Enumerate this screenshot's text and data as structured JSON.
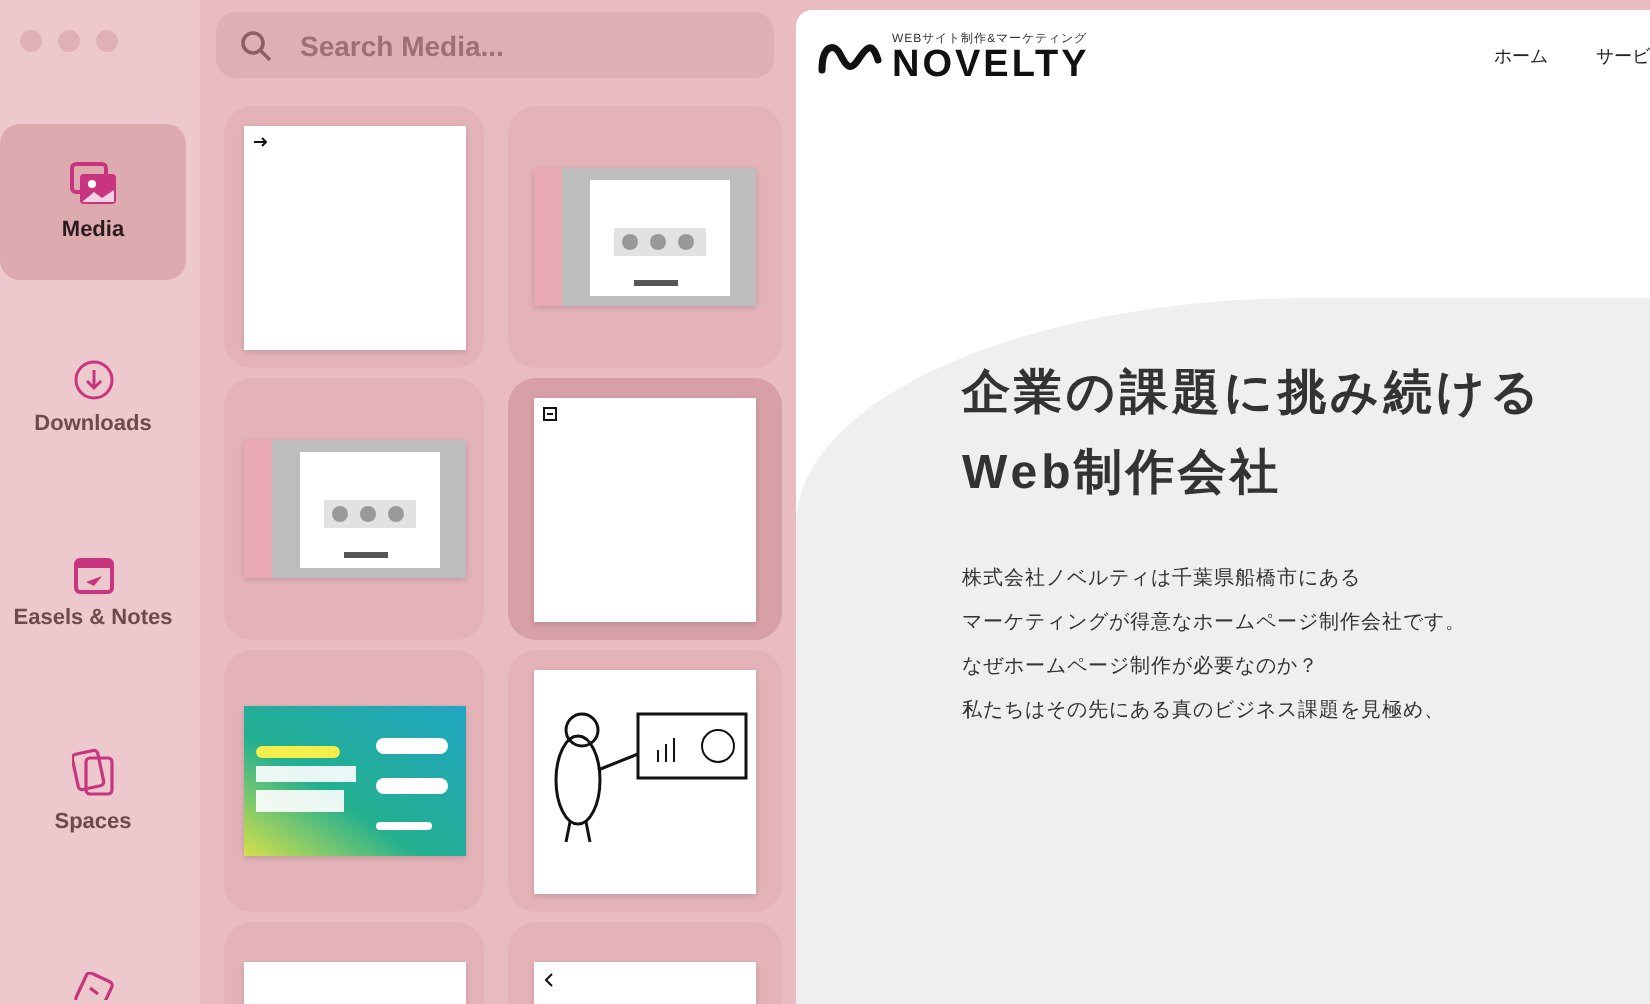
{
  "search": {
    "placeholder": "Search Media..."
  },
  "sidebar": {
    "items": [
      {
        "label": "Media",
        "kind": "media",
        "selected": true
      },
      {
        "label": "Downloads",
        "kind": "download",
        "selected": false
      },
      {
        "label": "Easels & Notes",
        "kind": "easel",
        "selected": false
      },
      {
        "label": "Spaces",
        "kind": "spaces",
        "selected": false
      },
      {
        "kind": "puzzle",
        "selected": false
      }
    ]
  },
  "media": {
    "items": [
      {
        "kind": "picture",
        "selected": false
      },
      {
        "kind": "picture",
        "selected": false
      },
      {
        "kind": "picture",
        "selected": false
      },
      {
        "kind": "picture",
        "selected": true
      },
      {
        "kind": "picture",
        "selected": false
      },
      {
        "kind": "picture",
        "selected": false
      },
      {
        "kind": "picture",
        "selected": false
      },
      {
        "kind": "picture",
        "selected": false
      }
    ]
  },
  "preview": {
    "tagline": "WEBサイト制作&マーケティング",
    "logo": "NOVELTY",
    "nav": [
      "ホーム",
      "サービ"
    ],
    "headline": [
      "企業の課題に挑み続ける",
      "Web制作会社"
    ],
    "body": [
      "株式会社ノベルティは千葉県船橋市にある",
      "マーケティングが得意なホームページ制作会社です。",
      "なぜホームページ制作が必要なのか？",
      "私たちはその先にある真のビジネス課題を見極め、"
    ]
  }
}
